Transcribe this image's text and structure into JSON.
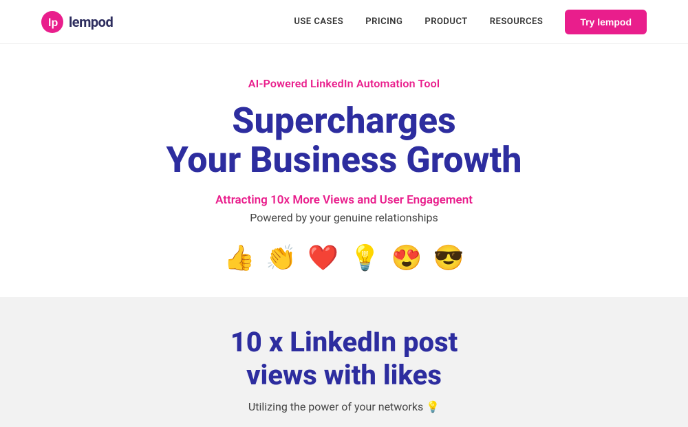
{
  "nav": {
    "logo_text": "lempod",
    "links": [
      {
        "label": "USE CASES",
        "id": "use-cases"
      },
      {
        "label": "PRICING",
        "id": "pricing"
      },
      {
        "label": "PRODUCT",
        "id": "product"
      },
      {
        "label": "RESOURCES",
        "id": "resources"
      }
    ],
    "cta_label": "Try lempod"
  },
  "hero": {
    "subtitle": "AI-Powered LinkedIn Automation Tool",
    "title_line1": "Supercharges",
    "title_line2": "Your Business Growth",
    "tagline": "Attracting 10x More Views and User Engagement",
    "description": "Powered by your genuine relationships",
    "emojis": [
      "👍",
      "👏",
      "❤️",
      "💡",
      "😍",
      "😎"
    ]
  },
  "bottom": {
    "title_line1": "10 x LinkedIn post",
    "title_line2": "views with likes",
    "description": "Utilizing the power of your networks 💡"
  }
}
